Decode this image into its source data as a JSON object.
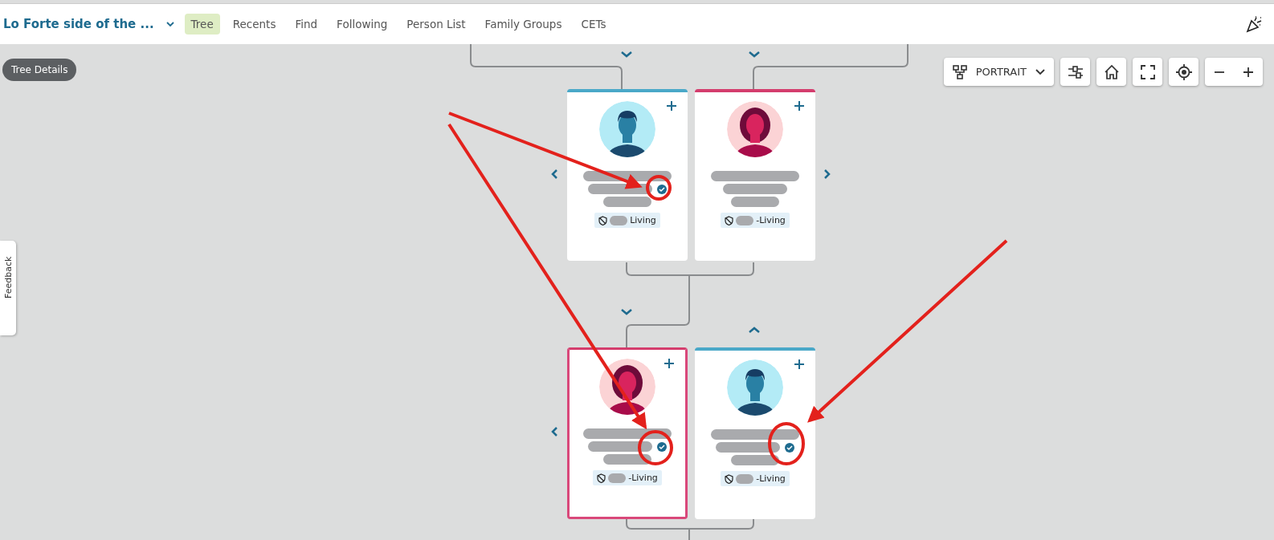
{
  "header": {
    "tree_name": "Lo Forte side of the ...",
    "tabs": [
      {
        "label": "Tree",
        "selected": true
      },
      {
        "label": "Recents",
        "selected": false
      },
      {
        "label": "Find",
        "selected": false
      },
      {
        "label": "Following",
        "selected": false
      },
      {
        "label": "Person List",
        "selected": false
      },
      {
        "label": "Family Groups",
        "selected": false
      },
      {
        "label": "CETs",
        "selected": false
      }
    ]
  },
  "tree_details": "Tree Details",
  "view_menu": {
    "label": "PORTRAIT"
  },
  "feedback": "Feedback",
  "persons": [
    {
      "kind": "male",
      "selected": false,
      "verified": true,
      "status": "Living"
    },
    {
      "kind": "female",
      "selected": false,
      "verified": false,
      "status": "-Living"
    },
    {
      "kind": "female",
      "selected": true,
      "verified": true,
      "status": "-Living"
    },
    {
      "kind": "male",
      "selected": false,
      "verified": true,
      "status": "-Living"
    }
  ]
}
